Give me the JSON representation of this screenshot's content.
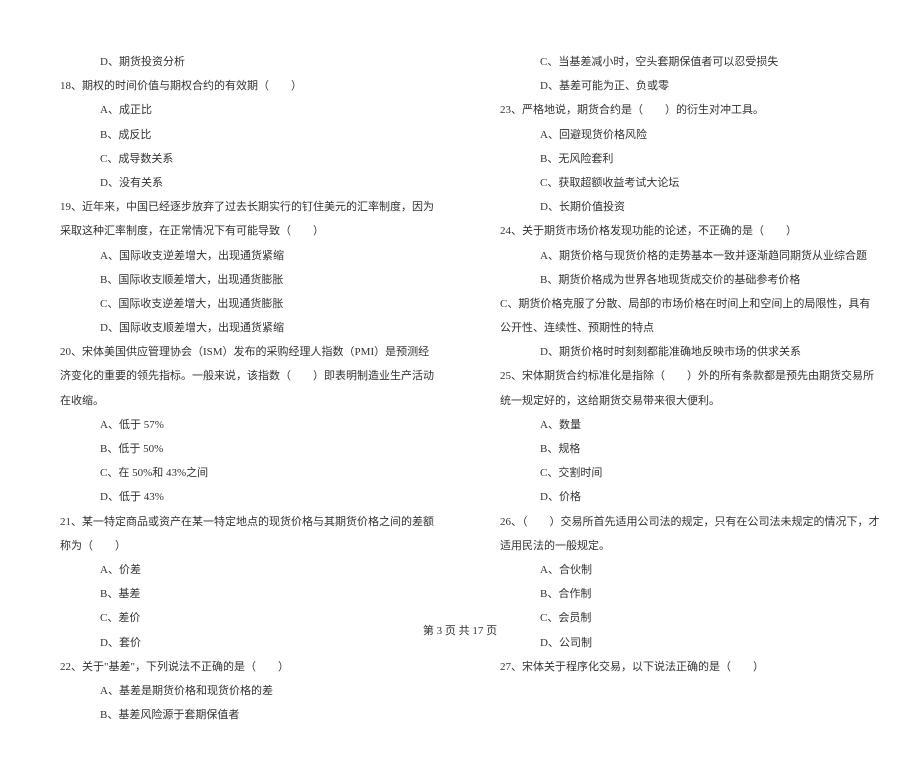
{
  "left": {
    "l0": "D、期货投资分析",
    "q18": "18、期权的时间价值与期权合约的有效期（　　）",
    "q18a": "A、成正比",
    "q18b": "B、成反比",
    "q18c": "C、成导数关系",
    "q18d": "D、没有关系",
    "q19": "19、近年来，中国已经逐步放弃了过去长期实行的钉住美元的汇率制度，因为采取这种汇率制度，在正常情况下有可能导致（　　）",
    "q19a": "A、国际收支逆差增大，出现通货紧缩",
    "q19b": "B、国际收支顺差增大，出现通货膨胀",
    "q19c": "C、国际收支逆差增大，出现通货膨胀",
    "q19d": "D、国际收支顺差增大，出现通货紧缩",
    "q20": "20、宋体美国供应管理协会（ISM）发布的采购经理人指数（PMI）是预测经济变化的重要的领先指标。一般来说，该指数（　　）即表明制造业生产活动在收缩。",
    "q20a": "A、低于 57%",
    "q20b": "B、低于 50%",
    "q20c": "C、在 50%和 43%之间",
    "q20d": "D、低于 43%",
    "q21": "21、某一特定商品或资产在某一特定地点的现货价格与其期货价格之间的差额称为（　　）",
    "q21a": "A、价差",
    "q21b": "B、基差",
    "q21c": "C、差价",
    "q21d": "D、套价",
    "q22": "22、关于\"基差\"，下列说法不正确的是（　　）",
    "q22a": "A、基差是期货价格和现货价格的差",
    "q22b": "B、基差风险源于套期保值者"
  },
  "right": {
    "q22c": "C、当基差减小时，空头套期保值者可以忍受损失",
    "q22d": "D、基差可能为正、负或零",
    "q23": "23、严格地说，期货合约是（　　）的衍生对冲工具。",
    "q23a": "A、回避现货价格风险",
    "q23b": "B、无风险套利",
    "q23c": "C、获取超额收益考试大论坛",
    "q23d": "D、长期价值投资",
    "q24": "24、关于期货市场价格发现功能的论述，不正确的是（　　）",
    "q24a": "A、期货价格与现货价格的走势基本一致并逐渐趋同期货从业综合题",
    "q24b": "B、期货价格成为世界各地现货成交价的基础参考价格",
    "q24c": "C、期货价格克服了分散、局部的市场价格在时间上和空间上的局限性，具有公开性、连续性、预期性的特点",
    "q24d": "D、期货价格时时刻刻都能准确地反映市场的供求关系",
    "q25": "25、宋体期货合约标准化是指除（　　）外的所有条款都是预先由期货交易所统一规定好的，这给期货交易带来很大便利。",
    "q25a": "A、数量",
    "q25b": "B、规格",
    "q25c": "C、交割时间",
    "q25d": "D、价格",
    "q26": "26、（　　）交易所首先适用公司法的规定，只有在公司法未规定的情况下，才适用民法的一般规定。",
    "q26a": "A、合伙制",
    "q26b": "B、合作制",
    "q26c": "C、会员制",
    "q26d": "D、公司制",
    "q27": "27、宋体关于程序化交易，以下说法正确的是（　　）"
  },
  "footer": "第 3 页 共 17 页"
}
